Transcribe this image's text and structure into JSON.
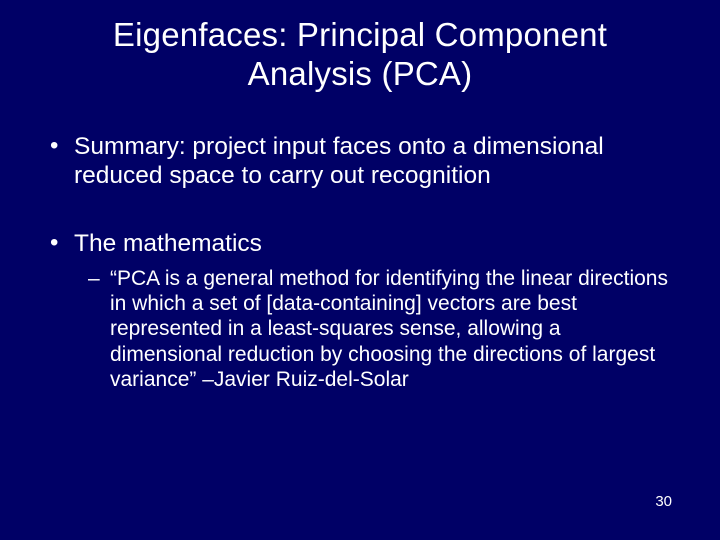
{
  "title_line1": "Eigenfaces: Principal Component",
  "title_line2": "Analysis (PCA)",
  "bullet1": "Summary: project input faces onto a dimensional reduced space to carry out recognition",
  "bullet2": "The mathematics",
  "subbullet": "“PCA is a general method for identifying the linear directions in which a set of [data-containing] vectors are best represented in a least-squares sense, allowing a dimensional reduction by choosing the directions of largest variance” –Javier Ruiz-del-Solar",
  "page_number": "30"
}
